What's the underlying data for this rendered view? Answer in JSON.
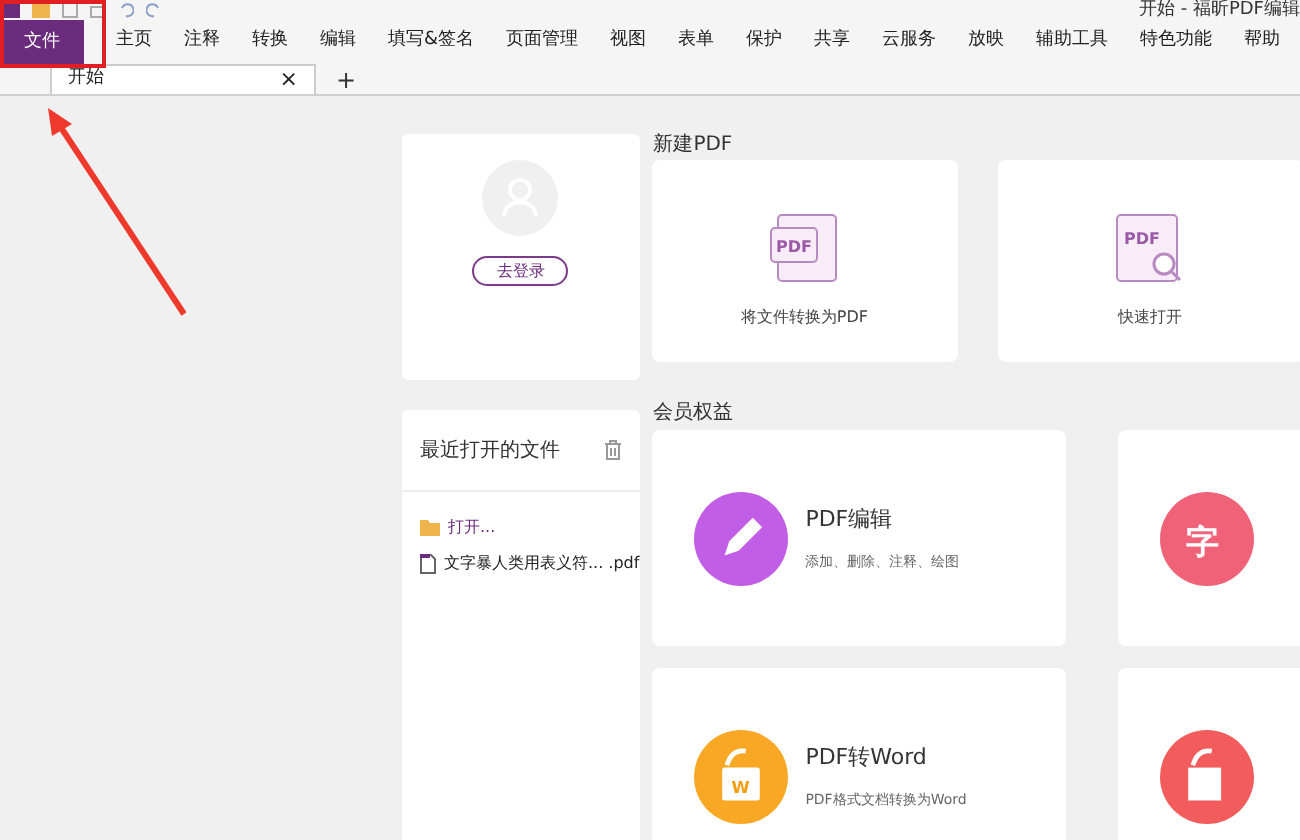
{
  "window": {
    "title": "开始 - 福昕PDF编辑"
  },
  "menu": [
    {
      "label": "文件",
      "selected": true
    },
    {
      "label": "主页",
      "selected": false
    },
    {
      "label": "注释",
      "selected": false
    },
    {
      "label": "转换",
      "selected": false
    },
    {
      "label": "编辑",
      "selected": false
    },
    {
      "label": "填写&签名",
      "selected": false
    },
    {
      "label": "页面管理",
      "selected": false
    },
    {
      "label": "视图",
      "selected": false
    },
    {
      "label": "表单",
      "selected": false
    },
    {
      "label": "保护",
      "selected": false
    },
    {
      "label": "共享",
      "selected": false
    },
    {
      "label": "云服务",
      "selected": false
    },
    {
      "label": "放映",
      "selected": false
    },
    {
      "label": "辅助工具",
      "selected": false
    },
    {
      "label": "特色功能",
      "selected": false
    },
    {
      "label": "帮助",
      "selected": false
    }
  ],
  "tabs": [
    {
      "label": "开始",
      "close": "×",
      "selected": true
    }
  ],
  "new_tab": "+",
  "account": {
    "login": "去登录"
  },
  "recent": {
    "title": "最近打开的文件",
    "items": [
      {
        "kind": "open",
        "label": "打开..."
      },
      {
        "kind": "file",
        "label": "文字暴人类用表义符... .pdf"
      }
    ]
  },
  "new_pdf": {
    "title": "新建PDF",
    "cards": [
      {
        "kind": "convert",
        "icon_text": "PDF",
        "label": "将文件转换为PDF"
      },
      {
        "kind": "open",
        "icon_text": "PDF",
        "label": "快速打开"
      }
    ]
  },
  "member": {
    "title": "会员权益",
    "cards": [
      {
        "kind": "edit",
        "title": "PDF编辑",
        "desc": "添加、删除、注释、绘图",
        "color": "#c25ee6"
      },
      {
        "kind": "ocr",
        "icon_text": "字",
        "color": "#f06277"
      },
      {
        "kind": "word",
        "icon_text": "W",
        "title": "PDF转Word",
        "desc": "PDF格式文档转换为Word",
        "color": "#f9a825"
      },
      {
        "kind": "share",
        "color": "#f25c5c"
      }
    ]
  }
}
